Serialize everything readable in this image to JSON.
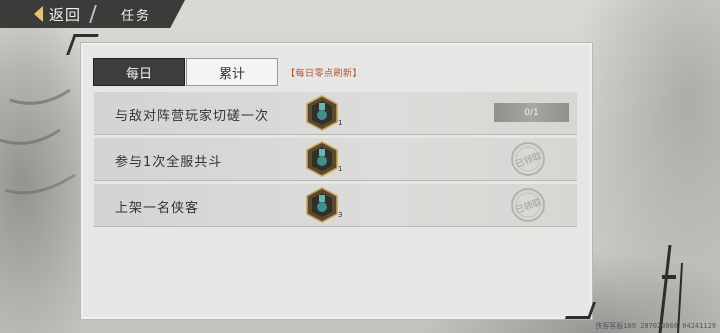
{
  "header": {
    "back_label": "返回",
    "title": "任务"
  },
  "tabs": [
    {
      "label": "每日",
      "active": true
    },
    {
      "label": "累计",
      "active": false
    }
  ],
  "refresh_note": "【每日零点刷新】",
  "tasks": [
    {
      "name": "与敌对阵营玩家切磋一次",
      "reward_count": "1",
      "status": "progress",
      "progress": "0/1"
    },
    {
      "name": "参与1次全服共斗",
      "reward_count": "1",
      "status": "claimed",
      "stamp_text": "已领取"
    },
    {
      "name": "上架一名侠客",
      "reward_count": "3",
      "status": "claimed",
      "stamp_text": "已领取"
    }
  ],
  "footer": "侠客客服109 287020860 04241129",
  "colors": {
    "accent_gold": "#e8c270",
    "refresh_note": "#b5502e",
    "reward_gem": "#3f8f8a"
  }
}
